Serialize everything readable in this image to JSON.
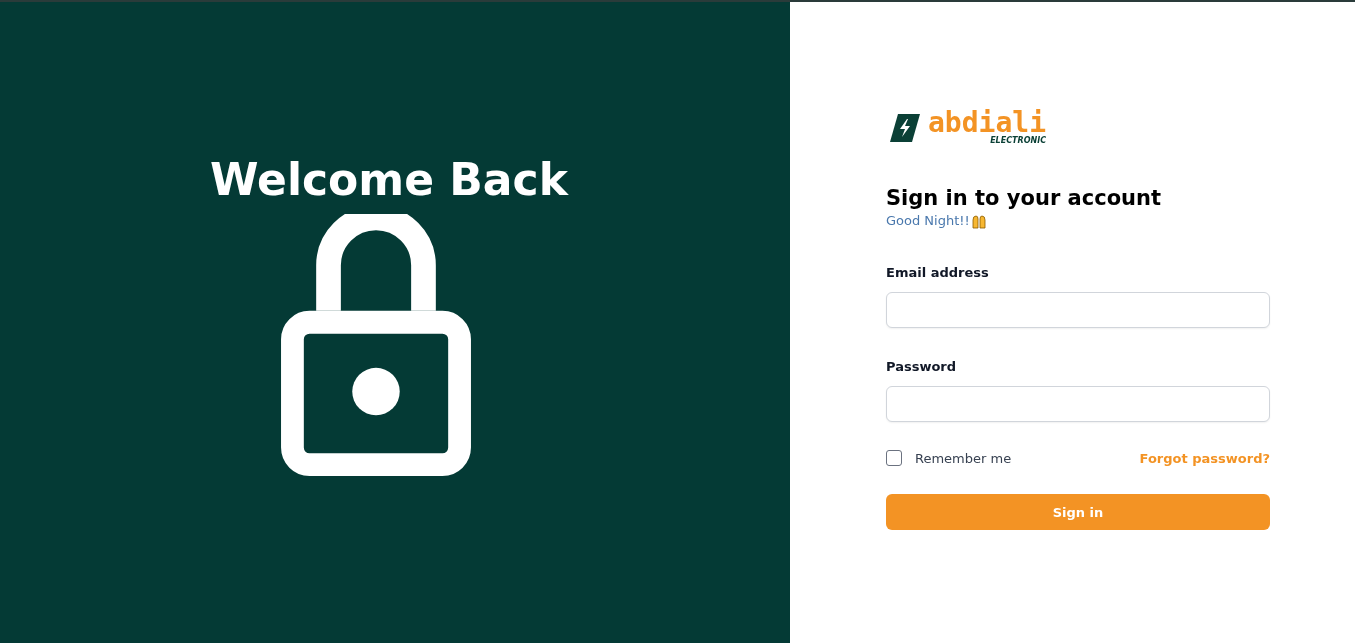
{
  "hero": {
    "title": "Welcome Back"
  },
  "logo": {
    "name": "abdiali",
    "tagline": "ELECTRONIC"
  },
  "heading": "Sign in to your account",
  "greeting": "Good Night!!",
  "fields": [
    {
      "label": "Email address"
    },
    {
      "label": "Password"
    }
  ],
  "remember": {
    "label": "Remember me",
    "checked": false
  },
  "forgot_link": "Forgot password?",
  "submit": "Sign in"
}
